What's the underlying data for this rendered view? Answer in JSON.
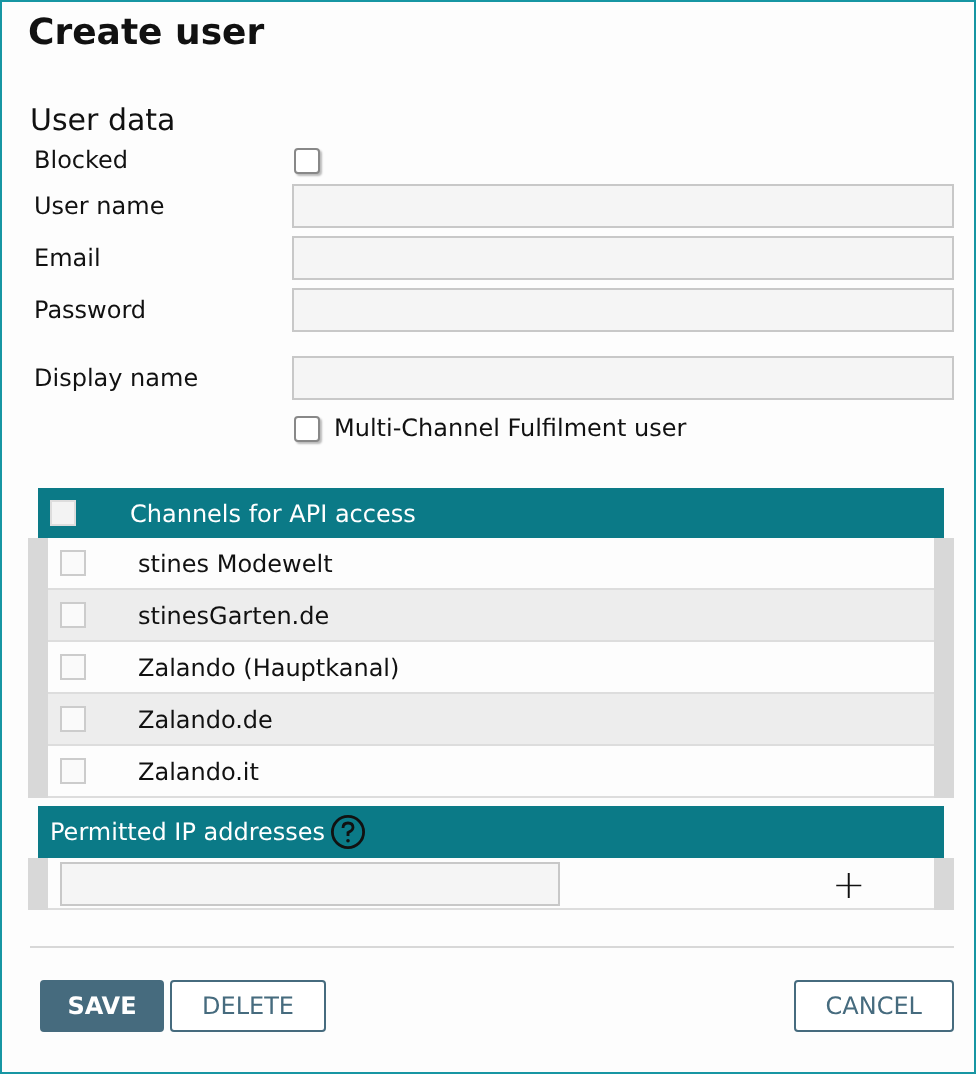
{
  "window": {
    "title": "Create user"
  },
  "section_title": "User data",
  "blocked": {
    "label": "Blocked",
    "checked": false
  },
  "fields": [
    {
      "label": "User name"
    },
    {
      "label": "Email"
    },
    {
      "label": "Password"
    },
    {
      "label": "Display name"
    }
  ],
  "mcf_user": {
    "label": "Multi-Channel Fulfilment user",
    "checked": false
  },
  "channels": {
    "header": "Channels for API access",
    "all_checked": false,
    "rows": [
      {
        "name": "stines Modewelt",
        "checked": false
      },
      {
        "name": "stinesGarten.de",
        "checked": false
      },
      {
        "name": "Zalando (Hauptkanal)",
        "checked": false
      },
      {
        "name": "Zalando.de",
        "checked": false
      },
      {
        "name": "Zalando.it",
        "checked": false
      }
    ]
  },
  "ip": {
    "header": "Permitted IP addresses",
    "add_symbol": "+"
  },
  "buttons": [
    {
      "label": "SAVE",
      "kind": "primary"
    },
    {
      "label": "DELETE",
      "kind": "secondary"
    },
    {
      "label": "CANCEL",
      "kind": "cancel"
    }
  ]
}
